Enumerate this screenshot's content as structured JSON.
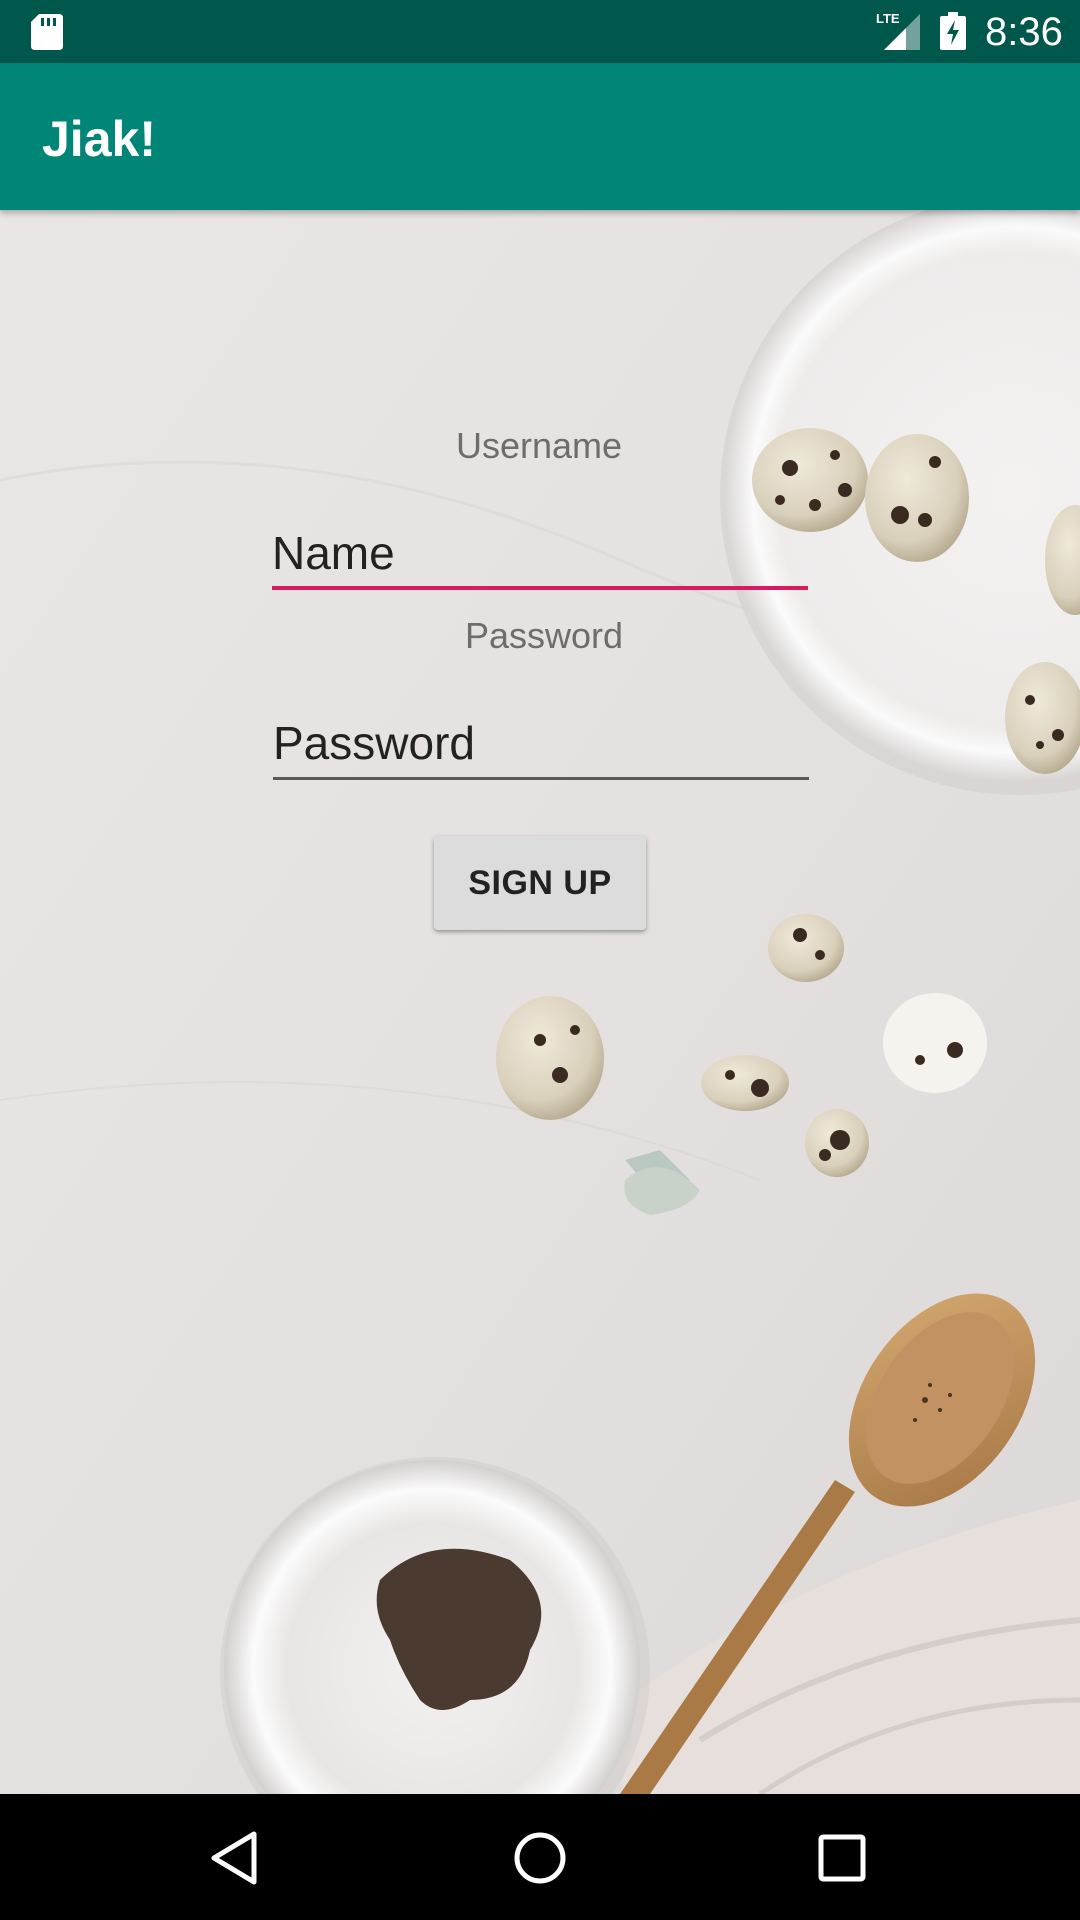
{
  "status_bar": {
    "time": "8:36",
    "network_label": "LTE",
    "icons": [
      "sd-card-icon",
      "lte-signal-icon",
      "battery-charging-icon"
    ]
  },
  "app_bar": {
    "title": "Jiak!",
    "color": "#008577",
    "status_color": "#00574b"
  },
  "form": {
    "username_label": "Username",
    "username_placeholder": "Name",
    "password_label": "Password",
    "password_placeholder": "Password",
    "signup_label": "SIGN UP",
    "accent_color": "#d81b60"
  },
  "nav_bar": {
    "icons": [
      "back-icon",
      "home-icon",
      "recents-icon"
    ]
  }
}
